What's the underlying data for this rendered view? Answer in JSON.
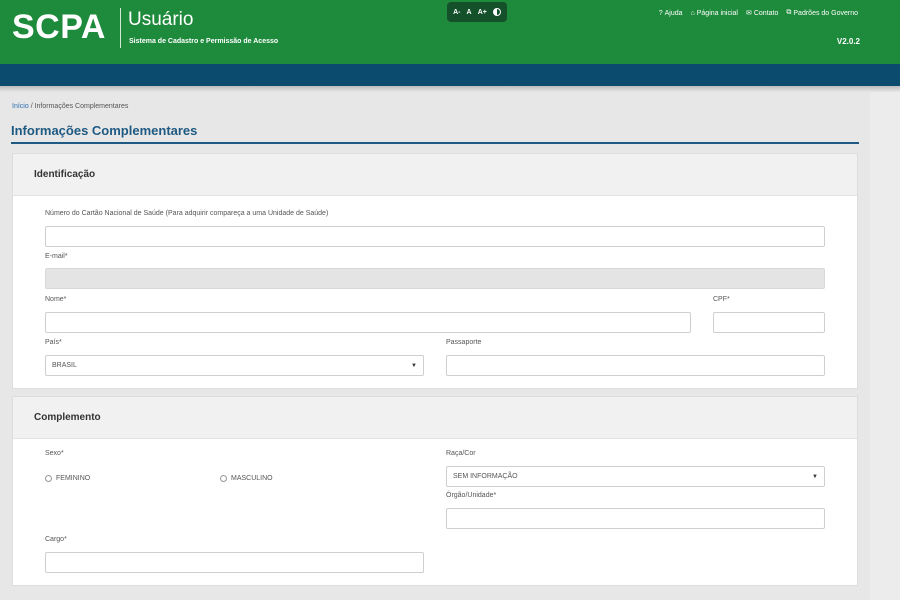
{
  "header": {
    "logo": "SCPA",
    "app_title": "Usuário",
    "app_subtitle": "Sistema de Cadastro e Permissão de Acesso",
    "accessibility": {
      "decrease": "A-",
      "normal": "A",
      "increase": "A+"
    },
    "links": [
      {
        "icon": "?",
        "label": "Ajuda"
      },
      {
        "icon": "⌂",
        "label": "Página inicial"
      },
      {
        "icon": "✉",
        "label": "Contato"
      },
      {
        "icon": "⧉",
        "label": "Padrões do Governo"
      }
    ],
    "version": "V2.0.2"
  },
  "breadcrumb": {
    "home": "Início",
    "separator": "/",
    "current": "Informações Complementares"
  },
  "page_title": "Informações Complementares",
  "identificacao": {
    "title": "Identificação",
    "cns_label": "Número do Cartão Nacional de Saúde (Para adquirir compareça a uma Unidade de Saúde)",
    "cns_value": "",
    "email_label": "E-mail*",
    "email_value": "",
    "nome_label": "Nome*",
    "nome_value": "",
    "cpf_label": "CPF*",
    "cpf_value": "",
    "pais_label": "País*",
    "pais_value": "BRASIL",
    "passaporte_label": "Passaporte",
    "passaporte_value": ""
  },
  "complemento": {
    "title": "Complemento",
    "sexo_label": "Sexo*",
    "sexo_options": [
      "FEMININO",
      "MASCULINO"
    ],
    "raca_label": "Raça/Cor",
    "raca_value": "SEM INFORMAÇÃO",
    "orgao_label": "Órgão/Unidade*",
    "orgao_value": "",
    "cargo_label": "Cargo*",
    "cargo_value": ""
  },
  "colors": {
    "header_green": "#1e8a3c",
    "navbar_blue": "#0b4b6e",
    "title_blue": "#1f5a82"
  }
}
